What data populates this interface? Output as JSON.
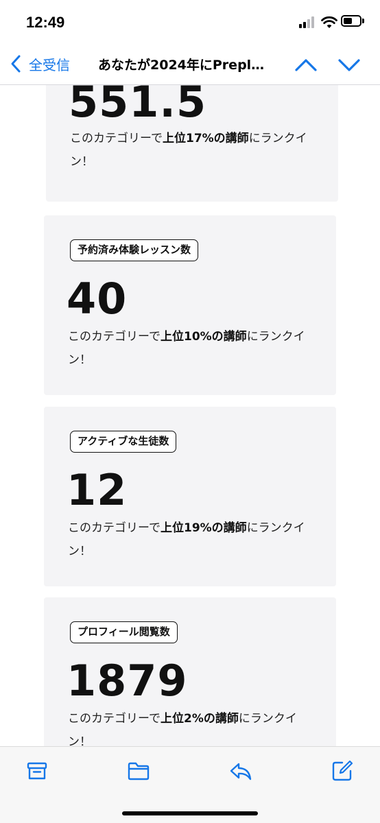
{
  "status_bar": {
    "time": "12:49"
  },
  "nav": {
    "back_label": "全受信",
    "title": "あなたが2024年にPrepl…",
    "prev_icon": "chevron-up-icon",
    "next_icon": "chevron-down-icon"
  },
  "cards": [
    {
      "label": "",
      "number": "551.5",
      "desc_pre": "このカテゴリーで",
      "desc_bold": "上位17%の講師",
      "desc_post": "にランクイン！"
    },
    {
      "label": "予約済み体験レッスン数",
      "number": "40",
      "desc_pre": "このカテゴリーで",
      "desc_bold": "上位10%の講師",
      "desc_post": "にランクイン！"
    },
    {
      "label": "アクティブな生徒数",
      "number": "12",
      "desc_pre": "このカテゴリーで",
      "desc_bold": "上位19%の講師",
      "desc_post": "にランクイン！"
    },
    {
      "label": "プロフィール閲覧数",
      "number": "1879",
      "desc_pre": "このカテゴリーで",
      "desc_bold": "上位2%の講師",
      "desc_post": "にランクイン！"
    }
  ],
  "toolbar": {
    "icons": [
      "archive-icon",
      "folder-icon",
      "reply-icon",
      "compose-icon"
    ]
  },
  "colors": {
    "accent": "#1677e8",
    "card_bg": "#f4f4f6"
  }
}
